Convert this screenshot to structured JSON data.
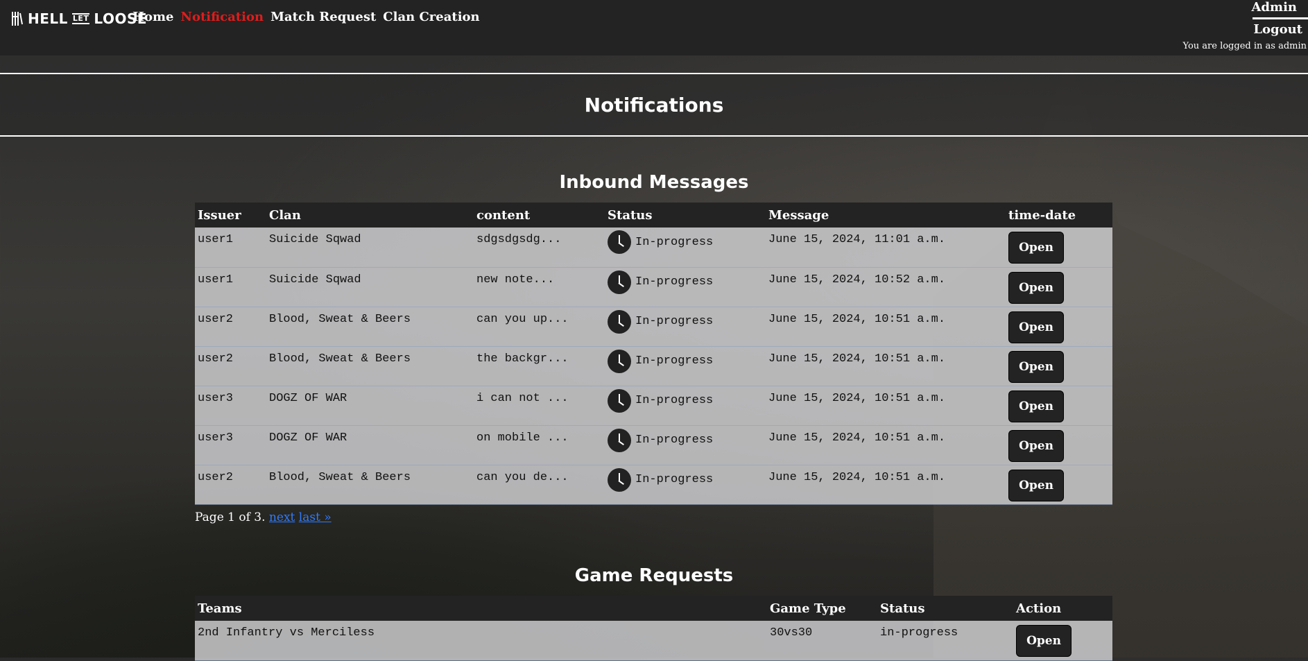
{
  "nav": {
    "logo_left": "HELL",
    "logo_mid": "LET",
    "logo_right": "LOOSE",
    "links": [
      "Home",
      "Notification",
      "Match Request",
      "Clan Creation"
    ],
    "active": "Notification"
  },
  "user": {
    "name": "Admin",
    "logout": "Logout",
    "note": "You are logged in as admin"
  },
  "page_title": "Notifications",
  "inbound": {
    "heading": "Inbound Messages",
    "columns": [
      "Issuer",
      "Clan",
      "content",
      "Status",
      "Message",
      "time-date"
    ],
    "rows": [
      {
        "issuer": "user1",
        "clan": "Suicide Sqwad",
        "content": "sdgsdgsdg...",
        "status": "In-progress",
        "message": "June 15, 2024, 11:01 a.m.",
        "action": "Open"
      },
      {
        "issuer": "user1",
        "clan": "Suicide Sqwad",
        "content": "new note...",
        "status": "In-progress",
        "message": "June 15, 2024, 10:52 a.m.",
        "action": "Open"
      },
      {
        "issuer": "user2",
        "clan": "Blood, Sweat & Beers",
        "content": "can you up...",
        "status": "In-progress",
        "message": "June 15, 2024, 10:51 a.m.",
        "action": "Open"
      },
      {
        "issuer": "user2",
        "clan": "Blood, Sweat & Beers",
        "content": "the backgr...",
        "status": "In-progress",
        "message": "June 15, 2024, 10:51 a.m.",
        "action": "Open"
      },
      {
        "issuer": "user3",
        "clan": "DOGZ OF WAR",
        "content": "i can not ...",
        "status": "In-progress",
        "message": "June 15, 2024, 10:51 a.m.",
        "action": "Open"
      },
      {
        "issuer": "user3",
        "clan": "DOGZ OF WAR",
        "content": "on mobile ...",
        "status": "In-progress",
        "message": "June 15, 2024, 10:51 a.m.",
        "action": "Open"
      },
      {
        "issuer": "user2",
        "clan": "Blood, Sweat & Beers",
        "content": "can you de...",
        "status": "In-progress",
        "message": "June 15, 2024, 10:51 a.m.",
        "action": "Open"
      }
    ],
    "pager": {
      "text": "Page 1 of 3.",
      "next": "next",
      "last": "last »"
    }
  },
  "game_requests": {
    "heading": "Game Requests",
    "columns": [
      "Teams",
      "Game Type",
      "Status",
      "Action"
    ],
    "rows": [
      {
        "teams": "2nd Infantry vs Merciless",
        "game_type": "30vs30",
        "status": "in-progress",
        "action": "Open"
      }
    ]
  },
  "colors": {
    "active_link": "#e21b1b",
    "link": "#2f7bff",
    "navbar": "#232323"
  }
}
